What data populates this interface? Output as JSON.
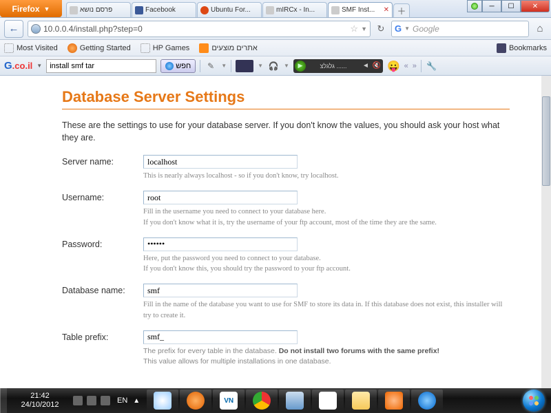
{
  "firefox_button": "Firefox",
  "tabs": [
    {
      "label": "פרסם נושא",
      "active": false
    },
    {
      "label": "Facebook",
      "active": false
    },
    {
      "label": "Ubuntu For...",
      "active": false
    },
    {
      "label": "mIRCx - In...",
      "active": false
    },
    {
      "label": "SMF Inst...",
      "active": true
    }
  ],
  "url": "10.0.0.4/install.php?step=0",
  "search_placeholder": "Google",
  "bookmarks": [
    "Most Visited",
    "Getting Started",
    "HP Games",
    "אתרים מוצעים"
  ],
  "bookmarks_right": "Bookmarks",
  "gbar": {
    "logo_rest": ".co.il",
    "search_value": "install smf tar",
    "button_label": "חפש",
    "player_text": "גלגלצ ......"
  },
  "page": {
    "title": "Database Server Settings",
    "intro": "These are the settings to use for your database server. If you don't know the values, you should ask your host what they are.",
    "fields": {
      "server": {
        "label": "Server name:",
        "value": "localhost",
        "hint": "This is nearly always localhost - so if you don't know, try localhost."
      },
      "user": {
        "label": "Username:",
        "value": "root",
        "hint": "Fill in the username you need to connect to your database here.\nIf you don't know what it is, try the username of your ftp account, most of the time they are the same."
      },
      "pass": {
        "label": "Password:",
        "value": "••••••",
        "hint": "Here, put the password you need to connect to your database.\nIf you don't know this, you should try the password to your ftp account."
      },
      "db": {
        "label": "Database name:",
        "value": "smf",
        "hint": "Fill in the name of the database you want to use for SMF to store its data in. If this database does not exist, this installer will try to create it."
      },
      "prefix": {
        "label": "Table prefix:",
        "value": "smf_",
        "hint_a": "The prefix for every table in the database. ",
        "hint_b": "Do not install two forums with the same prefix!",
        "hint_c": "This value allows for multiple installations in one database."
      }
    }
  },
  "taskbar": {
    "time": "21:42",
    "date": "24/10/2012",
    "lang": "EN"
  }
}
